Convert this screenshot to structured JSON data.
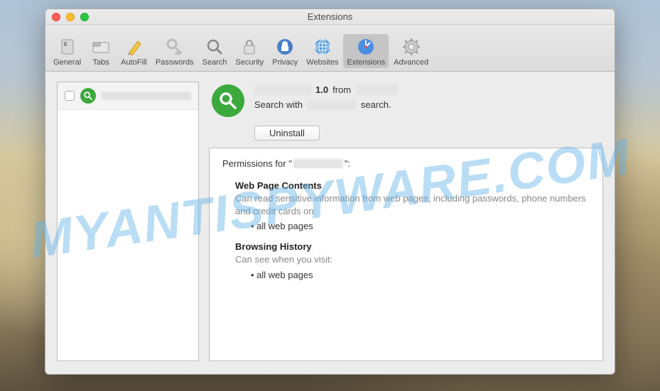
{
  "window": {
    "title": "Extensions"
  },
  "toolbar": {
    "items": [
      {
        "label": "General"
      },
      {
        "label": "Tabs"
      },
      {
        "label": "AutoFill"
      },
      {
        "label": "Passwords"
      },
      {
        "label": "Search"
      },
      {
        "label": "Security"
      },
      {
        "label": "Privacy"
      },
      {
        "label": "Websites"
      },
      {
        "label": "Extensions"
      },
      {
        "label": "Advanced"
      }
    ]
  },
  "detail": {
    "version": "1.0",
    "from_label": "from",
    "description_prefix": "Search with",
    "description_suffix": "search.",
    "uninstall": "Uninstall"
  },
  "permissions": {
    "for_prefix": "Permissions for \"",
    "for_suffix": "\":",
    "sections": [
      {
        "heading": "Web Page Contents",
        "desc": "Can read sensitive information from web pages, including passwords, phone numbers and credit cards on:",
        "items": [
          "all web pages"
        ]
      },
      {
        "heading": "Browsing History",
        "desc": "Can see when you visit:",
        "items": [
          "all web pages"
        ]
      }
    ]
  },
  "watermark": "MYANTISPYWARE.COM"
}
